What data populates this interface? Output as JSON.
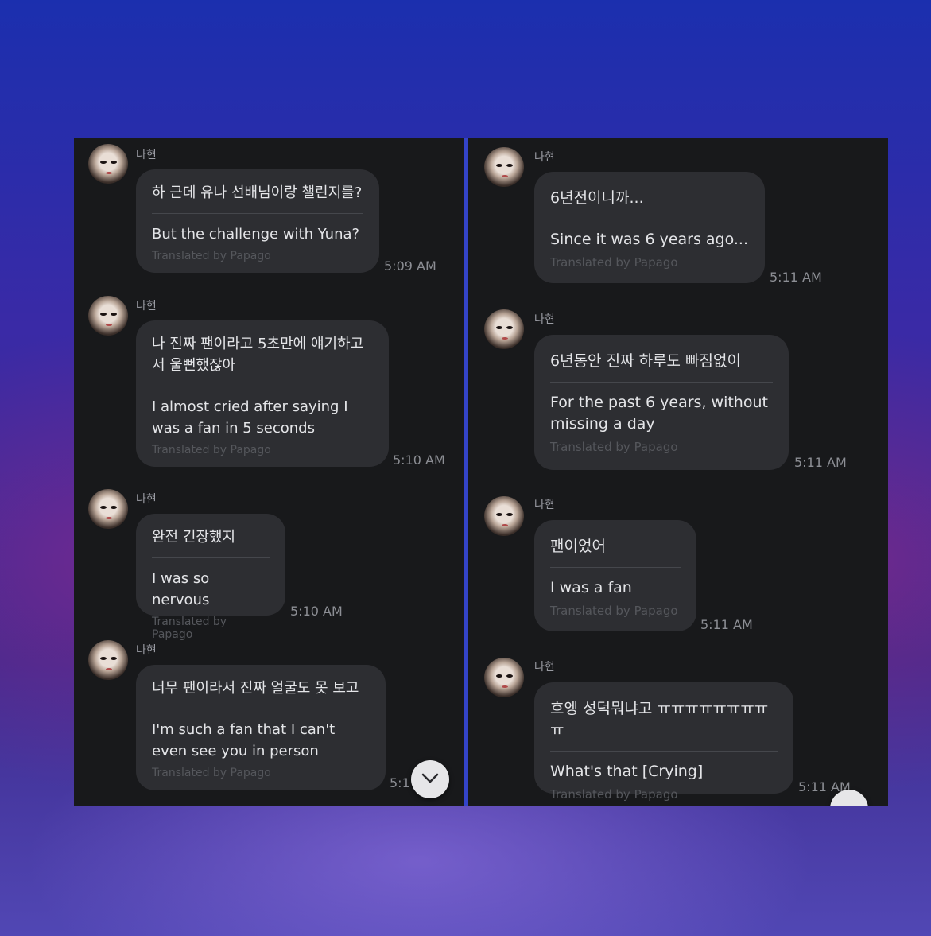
{
  "left": {
    "messages": [
      {
        "name": "나현",
        "original": "하 근데 유나 선배님이랑 챌린지를?",
        "translation": "But the challenge with Yuna?",
        "credit": "Translated by Papago",
        "time": "5:09 AM"
      },
      {
        "name": "나현",
        "original": "나 진짜 팬이라고 5초만에 얘기하고서 울뻔했잖아",
        "translation": "I almost cried after saying I was a fan in 5 seconds",
        "credit": "Translated by Papago",
        "time": "5:10 AM"
      },
      {
        "name": "나현",
        "original": "완전 긴장했지",
        "translation": "I was so nervous",
        "credit": "Translated by Papago",
        "time": "5:10 AM"
      },
      {
        "name": "나현",
        "original": "너무 팬이라서 진짜 얼굴도 못 보고",
        "translation": "I'm such a fan that I can't even see you in person",
        "credit": "Translated by Papago",
        "time": "5:1"
      }
    ]
  },
  "right": {
    "messages": [
      {
        "name": "나현",
        "original": "6년전이니까...",
        "translation": "Since it was 6 years ago...",
        "credit": "Translated by Papago",
        "time": "5:11 AM"
      },
      {
        "name": "나현",
        "original": "6년동안 진짜 하루도 빠짐없이",
        "translation": "For the past 6 years, without missing a day",
        "credit": "Translated by Papago",
        "time": "5:11 AM"
      },
      {
        "name": "나현",
        "original": "팬이었어",
        "translation": "I was a fan",
        "credit": "Translated by Papago",
        "time": "5:11 AM"
      },
      {
        "name": "나현",
        "original": "흐엥 성덕뭐냐고 ㅠㅠㅠㅠㅠㅠㅠㅠㅠ",
        "translation": "What's that [Crying]",
        "credit": "Translated by Papago",
        "time": "5:11 AM"
      }
    ]
  },
  "icons": {
    "scroll_down": "chevron-down-icon"
  }
}
